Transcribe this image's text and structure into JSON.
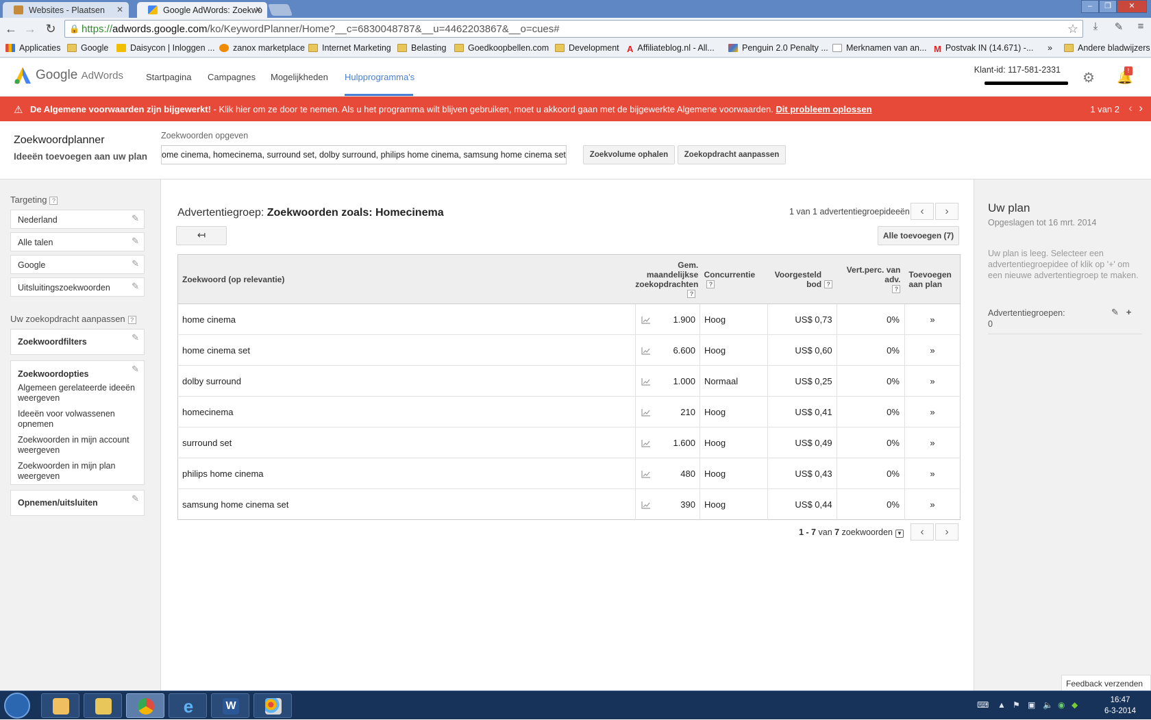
{
  "browser": {
    "tabs": [
      {
        "title": "Websites - Plaatsen",
        "active": false
      },
      {
        "title": "Google AdWords: Zoekwo",
        "active": true
      }
    ],
    "url_scheme": "https://",
    "url_host": "adwords.google.com",
    "url_path": "/ko/KeywordPlanner/Home?__c=6830048787&__u=4462203867&__o=cues#",
    "bookmarks": [
      "Applicaties",
      "Google",
      "Daisycon | Inloggen ...",
      "zanox marketplace",
      "Internet Marketing",
      "Belasting",
      "Goedkoopbellen.com",
      "Development",
      "Affiliateblog.nl - All...",
      "Penguin 2.0 Penalty ...",
      "Merknamen van an...",
      "Postvak IN (14.671) -...",
      "»",
      "Andere bladwijzers"
    ]
  },
  "header": {
    "logo_google": "Google",
    "logo_product": "AdWords",
    "nav": [
      "Startpagina",
      "Campagnes",
      "Mogelijkheden",
      "Hulpprogramma's"
    ],
    "account_id": "Klant-id: 117-581-2331",
    "notification_count": "!"
  },
  "alert": {
    "bold": "De Algemene voorwaarden zijn bijgewerkt!",
    "text": " - Klik hier om ze door te nemen. Als u het programma wilt blijven gebruiken, moet u akkoord gaan met de bijgewerkte Algemene voorwaarden. ",
    "link": "Dit probleem oplossen",
    "pager": "1 van 2"
  },
  "planner": {
    "title": "Zoekwoordplanner",
    "subtitle": "Ideeën toevoegen aan uw plan",
    "keywords_label": "Zoekwoorden opgeven",
    "keywords_value": "ome cinema, homecinema, surround set, dolby surround, philips home cinema, samsung home cinema set",
    "btn_volume": "Zoekvolume ophalen",
    "btn_modify": "Zoekopdracht aanpassen"
  },
  "sidebar": {
    "targeting_label": "Targeting",
    "targeting_items": [
      "Nederland",
      "Alle talen",
      "Google",
      "Uitsluitingszoekwoorden"
    ],
    "modify_label": "Uw zoekopdracht aanpassen",
    "filters": "Zoekwoordfilters",
    "options_title": "Zoekwoordopties",
    "options": [
      "Algemeen gerelateerde ideeën weergeven",
      "Ideeën voor volwassenen opnemen",
      "Zoekwoorden in mijn account weergeven",
      "Zoekwoorden in mijn plan weergeven"
    ],
    "include_exclude": "Opnemen/uitsluiten"
  },
  "main": {
    "adgroup_prefix": "Advertentiegroep: ",
    "adgroup_name": "Zoekwoorden zoals: Homecinema",
    "idea_count": "1 van 1 advertentiegroepideeën",
    "add_all": "Alle toevoegen (7)",
    "columns": {
      "keyword": "Zoekwoord (op relevantie)",
      "volume": "Gem. maandelijkse zoekopdrachten",
      "competition": "Concurrentie",
      "bid": "Voorgesteld bod",
      "share": "Vert.perc. van adv.",
      "add": "Toevoegen aan plan"
    },
    "rows": [
      {
        "keyword": "home cinema",
        "volume": "1.900",
        "competition": "Hoog",
        "bid": "US$ 0,73",
        "share": "0%"
      },
      {
        "keyword": "home cinema set",
        "volume": "6.600",
        "competition": "Hoog",
        "bid": "US$ 0,60",
        "share": "0%"
      },
      {
        "keyword": "dolby surround",
        "volume": "1.000",
        "competition": "Normaal",
        "bid": "US$ 0,25",
        "share": "0%"
      },
      {
        "keyword": "homecinema",
        "volume": "210",
        "competition": "Hoog",
        "bid": "US$ 0,41",
        "share": "0%"
      },
      {
        "keyword": "surround set",
        "volume": "1.600",
        "competition": "Hoog",
        "bid": "US$ 0,49",
        "share": "0%"
      },
      {
        "keyword": "philips home cinema",
        "volume": "480",
        "competition": "Hoog",
        "bid": "US$ 0,43",
        "share": "0%"
      },
      {
        "keyword": "samsung home cinema set",
        "volume": "390",
        "competition": "Hoog",
        "bid": "US$ 0,44",
        "share": "0%"
      }
    ],
    "range_a": "1 - 7",
    "range_mid": " van ",
    "range_b": "7",
    "range_suffix": " zoekwoorden"
  },
  "plan": {
    "title": "Uw plan",
    "saved": "Opgeslagen tot 16 mrt. 2014",
    "empty": "Uw plan is leeg. Selecteer een advertentiegroepidee of klik op '+' om een nieuwe advertentiegroep te maken.",
    "adgroups_label": "Advertentiegroepen:",
    "adgroups_value": "0"
  },
  "feedback": "Feedback verzenden",
  "taskbar": {
    "time": "16:47",
    "date": "6-3-2014"
  },
  "colors": {
    "accent_blue": "#4a7fd3",
    "alert_red": "#e84a3a",
    "taskbar": "#18335a"
  }
}
